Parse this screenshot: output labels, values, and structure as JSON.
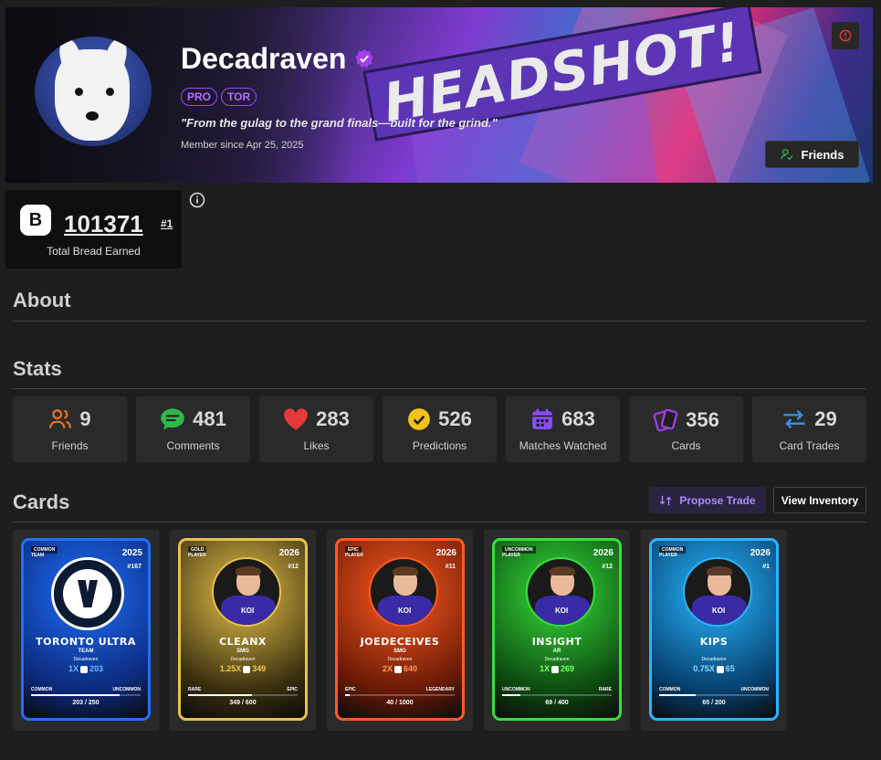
{
  "profile": {
    "username": "Decadraven",
    "tags": [
      "PRO",
      "TOR"
    ],
    "bio": "\"From the gulag to the grand finals—built for the grind.\"",
    "member_since": "Member since Apr 25, 2025",
    "banner_text": "HEADSHOT!",
    "friends_button": "Friends"
  },
  "bread": {
    "icon_letter": "B",
    "total": "101371",
    "rank": "#1",
    "label": "Total Bread Earned"
  },
  "sections": {
    "about": "About",
    "stats": "Stats",
    "cards": "Cards"
  },
  "stats": [
    {
      "value": "9",
      "label": "Friends",
      "icon": "users-icon",
      "color": "#e8732c"
    },
    {
      "value": "481",
      "label": "Comments",
      "icon": "chat-icon",
      "color": "#2eb84b"
    },
    {
      "value": "283",
      "label": "Likes",
      "icon": "heart-icon",
      "color": "#e53838"
    },
    {
      "value": "526",
      "label": "Predictions",
      "icon": "check-circle-icon",
      "color": "#f2c21b"
    },
    {
      "value": "683",
      "label": "Matches Watched",
      "icon": "calendar-icon",
      "color": "#8b4dff"
    },
    {
      "value": "356",
      "label": "Cards",
      "icon": "cards-icon",
      "color": "#9b3fe0"
    },
    {
      "value": "29",
      "label": "Card Trades",
      "icon": "arrows-swap-icon",
      "color": "#3b8de8"
    }
  ],
  "card_actions": {
    "propose_trade": "Propose Trade",
    "view_inventory": "View Inventory"
  },
  "cards": [
    {
      "rarity_top": "COMMON",
      "type_top": "TEAM",
      "year": "2025",
      "number": "#167",
      "name": "TORONTO ULTRA",
      "role": "TEAM",
      "owner": "Decadraven",
      "multiplier": "1X",
      "bread": "203",
      "rarity_left": "COMMON",
      "rarity_right": "UNCOMMON",
      "serial": "203 / 250",
      "progress": 0.81,
      "theme": "#1f6fff",
      "bg": "#0b2a7a",
      "value_color": "#6fb5ff"
    },
    {
      "rarity_top": "GOLD",
      "type_top": "PLAYER",
      "year": "2026",
      "number": "#12",
      "name": "CLEANX",
      "role": "SMG",
      "owner": "Decadraven",
      "multiplier": "1.25X",
      "bread": "349",
      "rarity_left": "RARE",
      "rarity_right": "EPIC",
      "serial": "349 / 600",
      "progress": 0.58,
      "theme": "#e8c24a",
      "bg": "#3a300f",
      "value_color": "#f1c94a"
    },
    {
      "rarity_top": "EPIC",
      "type_top": "PLAYER",
      "year": "2026",
      "number": "#11",
      "name": "JOEDECEIVES",
      "role": "SMG",
      "owner": "Decadraven",
      "multiplier": "2X",
      "bread": "640",
      "rarity_left": "EPIC",
      "rarity_right": "LEGENDARY",
      "serial": "40 / 1000",
      "progress": 0.04,
      "theme": "#ff5a1f",
      "bg": "#6a1a06",
      "value_color": "#ff9a5a"
    },
    {
      "rarity_top": "UNCOMMON",
      "type_top": "PLAYER",
      "year": "2026",
      "number": "#12",
      "name": "INSIGHT",
      "role": "AR",
      "owner": "Decadraven",
      "multiplier": "1X",
      "bread": "269",
      "rarity_left": "UNCOMMON",
      "rarity_right": "RARE",
      "serial": "69 / 400",
      "progress": 0.17,
      "theme": "#35e03a",
      "bg": "#0d4a10",
      "value_color": "#7dff6a"
    },
    {
      "rarity_top": "COMMON",
      "type_top": "PLAYER",
      "year": "2026",
      "number": "#1",
      "name": "KIPS",
      "role": "",
      "owner": "Decadraven",
      "multiplier": "0.75X",
      "bread": "65",
      "rarity_left": "COMMON",
      "rarity_right": "UNCOMMON",
      "serial": "65 / 200",
      "progress": 0.33,
      "theme": "#28b6ff",
      "bg": "#06406e",
      "value_color": "#8fd8ff"
    }
  ]
}
